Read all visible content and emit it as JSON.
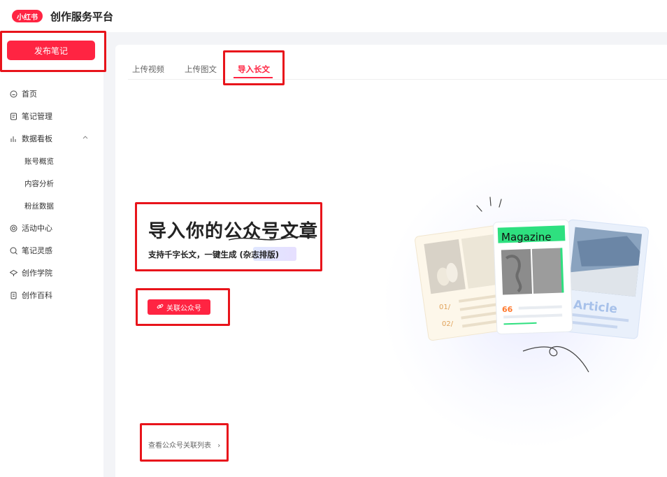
{
  "header": {
    "logo_text": "小红书",
    "app_title": "创作服务平台"
  },
  "sidebar": {
    "publish_label": "发布笔记",
    "items": [
      {
        "label": "首页",
        "icon": "home-icon"
      },
      {
        "label": "笔记管理",
        "icon": "note-icon"
      },
      {
        "label": "数据看板",
        "icon": "bar-chart-icon",
        "expanded": true
      },
      {
        "label": "账号概览"
      },
      {
        "label": "内容分析"
      },
      {
        "label": "粉丝数据"
      },
      {
        "label": "活动中心",
        "icon": "target-icon"
      },
      {
        "label": "笔记灵感",
        "icon": "bulb-icon"
      },
      {
        "label": "创作学院",
        "icon": "school-icon"
      },
      {
        "label": "创作百科",
        "icon": "book-icon"
      }
    ]
  },
  "tabs": [
    {
      "label": "上传视频"
    },
    {
      "label": "上传图文"
    },
    {
      "label": "导入长文",
      "active": true
    }
  ],
  "main": {
    "headline": "导入你的公众号文章",
    "subline_prefix": "支持千字长文，一键生成",
    "subline_highlight": "(杂志排版)",
    "link_button_label": "关联公众号",
    "view_list_label": "查看公众号关联列表"
  },
  "illustration": {
    "card_numbers": [
      "01/",
      "02/"
    ],
    "magazine_label": "Magazine",
    "quote_mark": "66",
    "article_label": "Article"
  },
  "colors": {
    "accent": "#ff2442",
    "annotation": "#e8141b",
    "magazine_green": "#2ee07f"
  }
}
